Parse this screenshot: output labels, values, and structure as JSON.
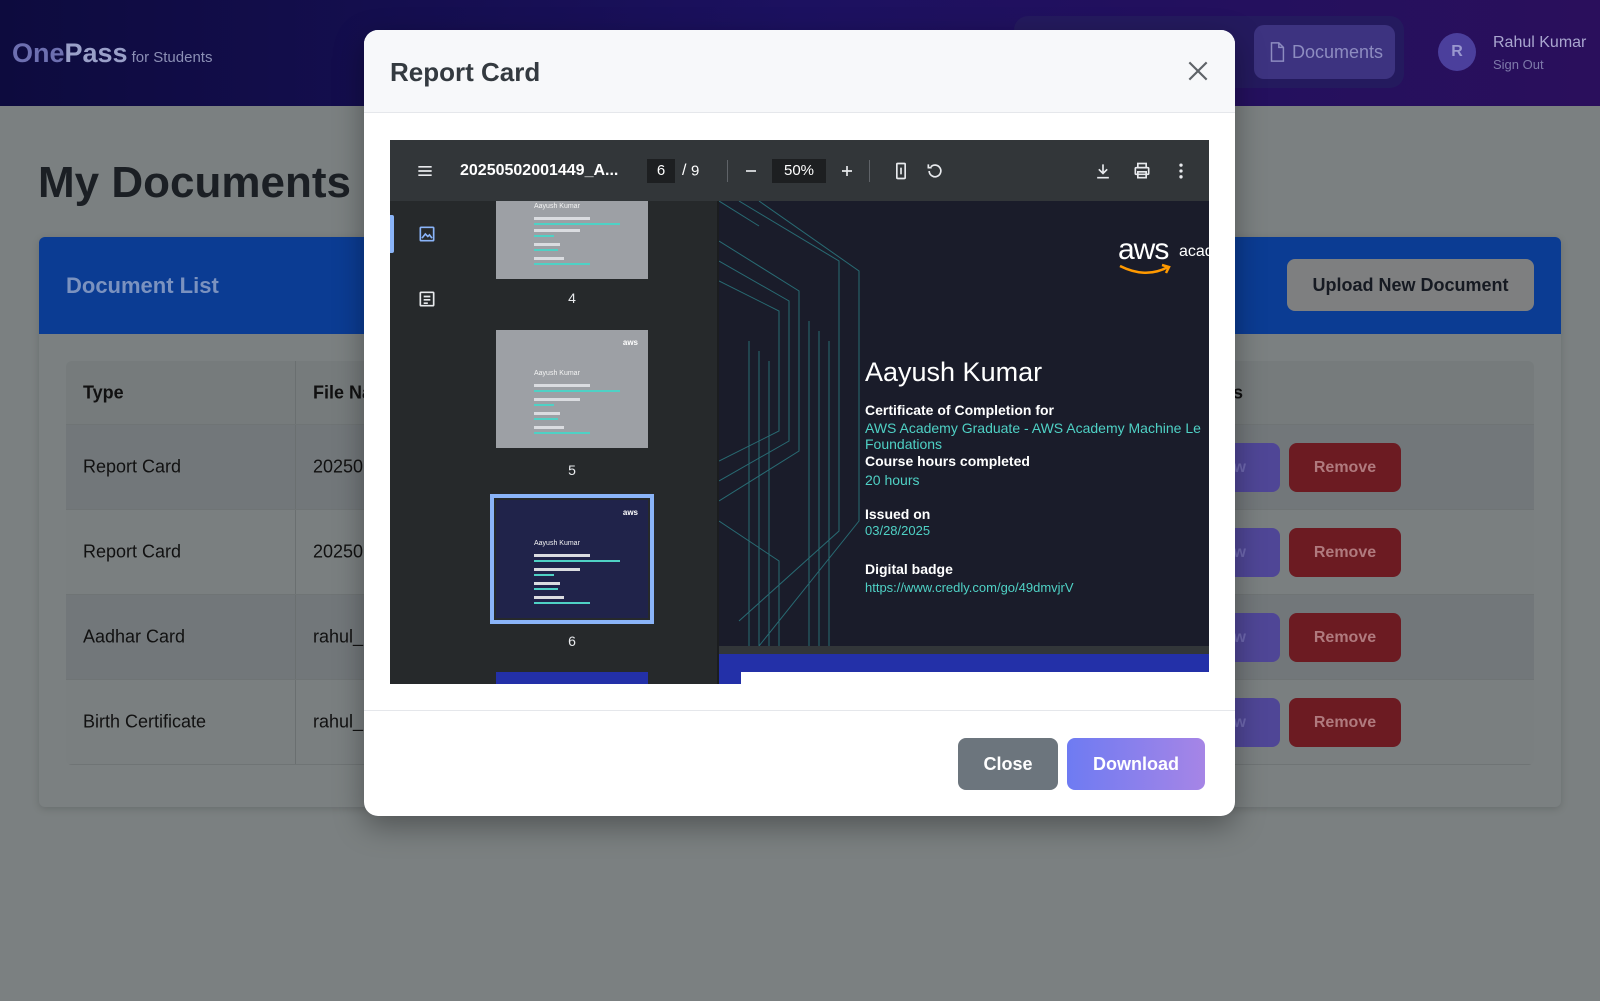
{
  "app": {
    "logo_one": "One",
    "logo_pass": "Pass",
    "logo_sub": "for Students",
    "nav_documents": "Documents",
    "avatar_initial": "R",
    "user_name": "Rahul Kumar",
    "sign_out": "Sign Out"
  },
  "page": {
    "title": "My Documents",
    "card_title": "Document List",
    "upload_label": "Upload New Document",
    "table": {
      "headers": {
        "type": "Type",
        "file": "File Na",
        "actions": "ons"
      },
      "rows": [
        {
          "type": "Report Card",
          "file": "20250",
          "view": "iew",
          "remove": "Remove"
        },
        {
          "type": "Report Card",
          "file": "20250",
          "view": "iew",
          "remove": "Remove"
        },
        {
          "type": "Aadhar Card",
          "file": "rahul_",
          "view": "iew",
          "remove": "Remove"
        },
        {
          "type": "Birth Certificate",
          "file": "rahul_",
          "view": "iew",
          "remove": "Remove"
        }
      ]
    }
  },
  "modal": {
    "title": "Report Card",
    "close_label": "Close",
    "download_label": "Download",
    "viewer": {
      "file_name": "20250502001449_A...",
      "current_page": "6",
      "page_sep": "/",
      "total_pages": "9",
      "zoom": "50%",
      "thumbnails": [
        {
          "label": "4",
          "name": "Aayush Kumar"
        },
        {
          "label": "5",
          "name": "Aayush Kumar"
        },
        {
          "label": "6",
          "name": "Aayush Kumar",
          "selected": true
        }
      ],
      "certificate": {
        "logo": "aws",
        "logo_suffix": "acad",
        "name": "Aayush Kumar",
        "completion_label": "Certificate of Completion for",
        "course_line1": "AWS Academy Graduate - AWS Academy Machine Le",
        "course_line2": "Foundations",
        "hours_label": "Course hours completed",
        "hours_value": "20 hours",
        "issued_label": "Issued on",
        "issued_value": "03/28/2025",
        "badge_label": "Digital badge",
        "badge_url": "https://www.credly.com/go/49dmvjrV"
      }
    }
  },
  "colors": {
    "header_bg": "#1c1160",
    "card_header": "#0b3c93",
    "remove": "#6c1b22",
    "download_start": "#6e7bf2",
    "download_end": "#a685e6",
    "cert_accent": "#4fd1c5"
  }
}
